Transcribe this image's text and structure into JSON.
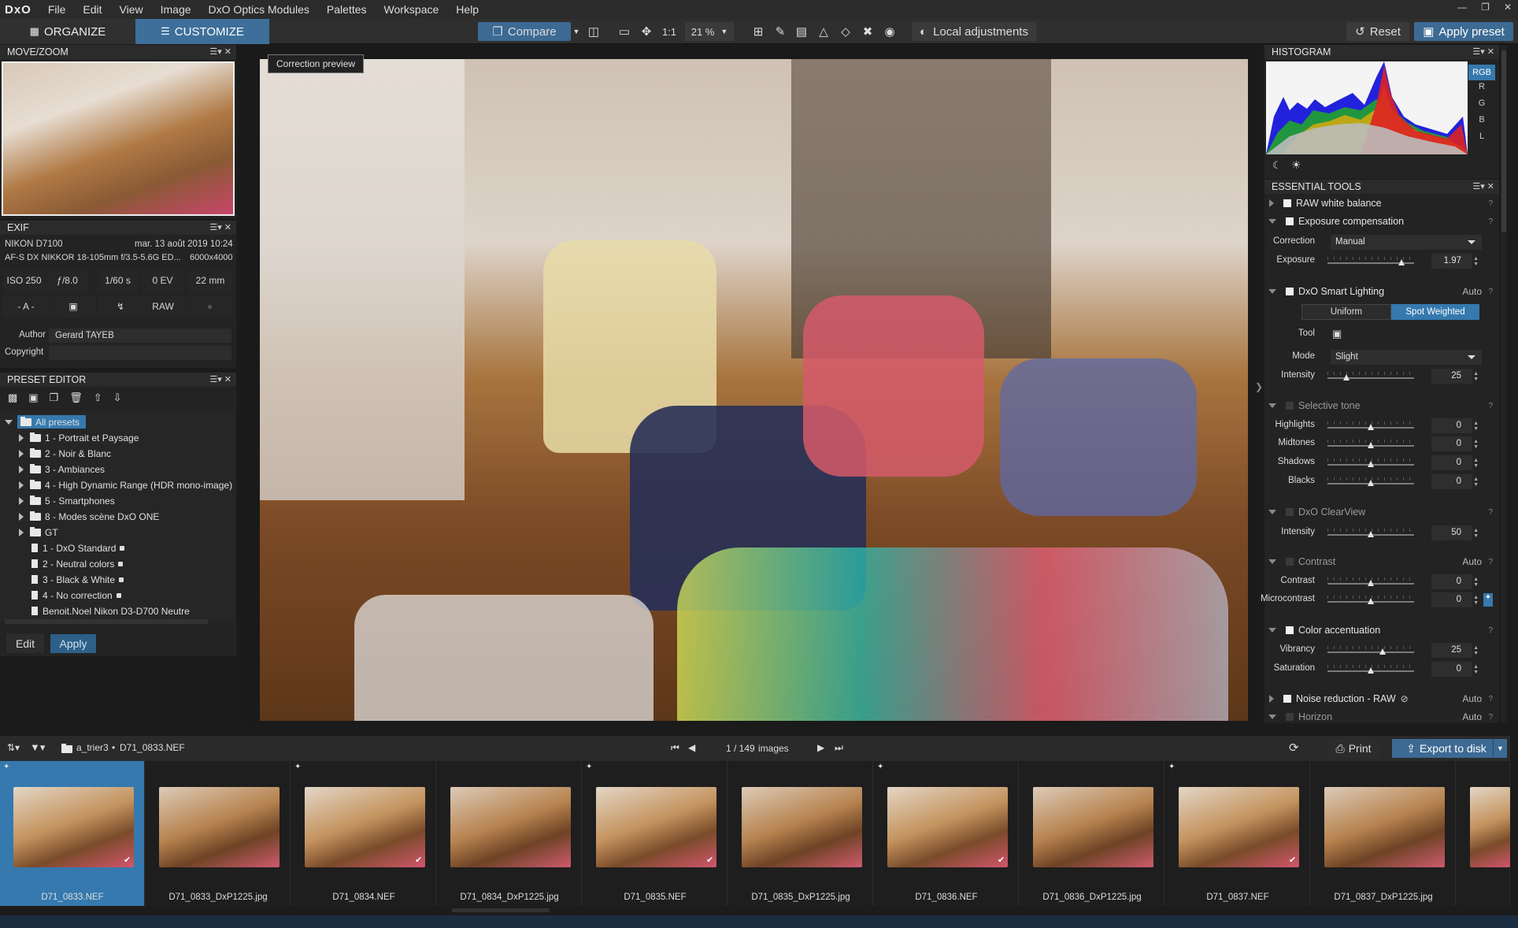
{
  "app": {
    "logo": "DxO"
  },
  "menu": [
    "File",
    "Edit",
    "View",
    "Image",
    "DxO Optics Modules",
    "Palettes",
    "Workspace",
    "Help"
  ],
  "toolbar": {
    "organize": "ORGANIZE",
    "customize": "CUSTOMIZE",
    "compare": "Compare",
    "one_to_one": "1:1",
    "zoom": "21 %",
    "local_adjustments": "Local adjustments",
    "reset": "Reset",
    "apply_preset": "Apply preset"
  },
  "movezoom": {
    "title": "MOVE/ZOOM"
  },
  "exif": {
    "title": "EXIF",
    "camera": "NIKON D7100",
    "date": "mar. 13 août 2019 10:24",
    "lens": "AF-S DX NIKKOR 18-105mm f/3.5-5.6G ED...",
    "size": "6000x4000",
    "iso": "ISO 250",
    "aperture": "ƒ/8.0",
    "shutter": "1/60 s",
    "ev": "0 EV",
    "focal": "22 mm",
    "mode": "- A -",
    "raw": "RAW",
    "author_label": "Author",
    "author": "Gerard TAYEB",
    "copyright_label": "Copyright",
    "copyright": ""
  },
  "preset_editor": {
    "title": "PRESET EDITOR",
    "root": "All presets",
    "folders": [
      "1 - Portrait et Paysage",
      "2 - Noir & Blanc",
      "3 - Ambiances",
      "4 - High Dynamic Range (HDR mono-image)",
      "5 - Smartphones",
      "8 - Modes scène DxO ONE",
      "GT"
    ],
    "presets": [
      "1 - DxO Standard",
      "2 - Neutral colors",
      "3 - Black & White",
      "4 - No correction",
      "Benoit.Noel Nikon D3-D700 Neutre"
    ],
    "edit": "Edit",
    "apply": "Apply"
  },
  "viewer": {
    "correction_preview": "Correction preview"
  },
  "histogram": {
    "title": "HISTOGRAM",
    "channels": [
      "RGB",
      "R",
      "G",
      "B",
      "L"
    ]
  },
  "essential_tools": {
    "title": "ESSENTIAL TOOLS",
    "raw_wb": "RAW white balance",
    "exposure_comp": "Exposure compensation",
    "correction_label": "Correction",
    "correction_value": "Manual",
    "exposure_label": "Exposure",
    "exposure_value": "1.97",
    "smart_lighting": "DxO Smart Lighting",
    "smart_auto": "Auto",
    "uniform": "Uniform",
    "spot_weighted": "Spot Weighted",
    "tool_label": "Tool",
    "mode_label": "Mode",
    "mode_value": "Slight",
    "intensity_label": "Intensity",
    "sl_intensity": "25",
    "selective_tone": "Selective tone",
    "highlights": "Highlights",
    "highlights_v": "0",
    "midtones": "Midtones",
    "midtones_v": "0",
    "shadows": "Shadows",
    "shadows_v": "0",
    "blacks": "Blacks",
    "blacks_v": "0",
    "clearview": "DxO ClearView",
    "cv_intensity": "50",
    "contrast_section": "Contrast",
    "contrast_auto": "Auto",
    "contrast": "Contrast",
    "contrast_v": "0",
    "microcontrast": "Microcontrast",
    "microcontrast_v": "0",
    "color_accent": "Color accentuation",
    "vibrancy": "Vibrancy",
    "vibrancy_v": "25",
    "saturation": "Saturation",
    "saturation_v": "0",
    "noise": "Noise reduction - RAW",
    "noise_auto": "Auto",
    "horizon": "Horizon",
    "horizon_auto": "Auto"
  },
  "filmbar": {
    "path_folder": "a_trier3",
    "path_file": "D71_0833.NEF",
    "counter": "1 / 149",
    "images": "images",
    "print": "Print",
    "export": "Export to disk"
  },
  "thumbnails": [
    "D71_0833.NEF",
    "D71_0833_DxP1225.jpg",
    "D71_0834.NEF",
    "D71_0834_DxP1225.jpg",
    "D71_0835.NEF",
    "D71_0835_DxP1225.jpg",
    "D71_0836.NEF",
    "D71_0836_DxP1225.jpg",
    "D71_0837.NEF",
    "D71_0837_DxP1225.jpg"
  ],
  "colors": {
    "accent": "#3d6f9a",
    "selected": "#3579ae"
  }
}
